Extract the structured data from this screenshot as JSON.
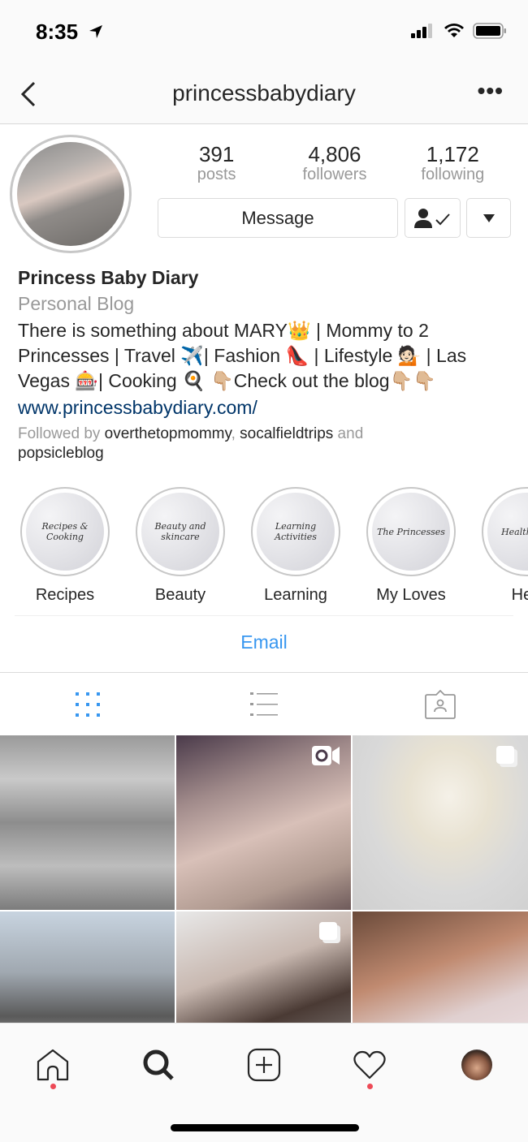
{
  "status_bar": {
    "time": "8:35",
    "location_icon": "location-arrow-icon",
    "signal_icon": "cellular-signal-icon",
    "wifi_icon": "wifi-icon",
    "battery_icon": "battery-icon"
  },
  "nav": {
    "back_icon": "chevron-left-icon",
    "title": "princessbabydiary",
    "more_label": "•••"
  },
  "profile": {
    "stats": [
      {
        "value": "391",
        "label": "posts"
      },
      {
        "value": "4,806",
        "label": "followers"
      },
      {
        "value": "1,172",
        "label": "following"
      }
    ],
    "message_label": "Message",
    "following_icon": "person-check-icon",
    "dropdown_icon": "caret-down-icon"
  },
  "bio": {
    "name": "Princess Baby Diary",
    "category": "Personal Blog",
    "text": "There is something about MARY👑 | Mommy to 2 Princesses | Travel ✈️| Fashion 👠 | Lifestyle 💁🏻 | Las Vegas 🎰| Cooking 🍳 👇🏼Check out the blog👇🏼👇🏼",
    "link": "www.princessbabydiary.com/",
    "followed_prefix": "Followed by ",
    "followed_users": [
      "overthetopmommy",
      "socalfieldtrips",
      "popsicleblog"
    ],
    "followed_sep": ", ",
    "followed_and": " and "
  },
  "highlights": [
    {
      "label": "Recipes",
      "cover_text": "Recipes & Cooking"
    },
    {
      "label": "Beauty",
      "cover_text": "Beauty and skincare"
    },
    {
      "label": "Learning",
      "cover_text": "Learning Activities"
    },
    {
      "label": "My Loves",
      "cover_text": "The Princesses"
    },
    {
      "label": "Hea",
      "cover_text": "Health and"
    }
  ],
  "contact": {
    "email_label": "Email"
  },
  "tabs": [
    {
      "name": "grid",
      "icon": "grid-icon",
      "active": true,
      "color": "#3897f0"
    },
    {
      "name": "list",
      "icon": "list-icon",
      "active": false
    },
    {
      "name": "tagged",
      "icon": "tagged-person-icon",
      "active": false
    }
  ],
  "posts": [
    {
      "type": "photo",
      "badge": null
    },
    {
      "type": "video",
      "badge": "video-icon"
    },
    {
      "type": "carousel",
      "badge": "carousel-icon"
    },
    {
      "type": "photo",
      "badge": null
    },
    {
      "type": "carousel",
      "badge": "carousel-icon"
    },
    {
      "type": "photo",
      "badge": null
    }
  ],
  "tab_bar": {
    "items": [
      {
        "name": "home",
        "icon": "home-icon",
        "notification_dot": true
      },
      {
        "name": "search",
        "icon": "search-icon",
        "notification_dot": false
      },
      {
        "name": "new-post",
        "icon": "plus-square-icon",
        "notification_dot": false
      },
      {
        "name": "activity",
        "icon": "heart-icon",
        "notification_dot": true
      },
      {
        "name": "profile",
        "icon": "profile-avatar",
        "notification_dot": false
      }
    ]
  },
  "colors": {
    "accent": "#3897f0",
    "link": "#003569",
    "notification": "#ed4956",
    "secondary_text": "#999999"
  }
}
